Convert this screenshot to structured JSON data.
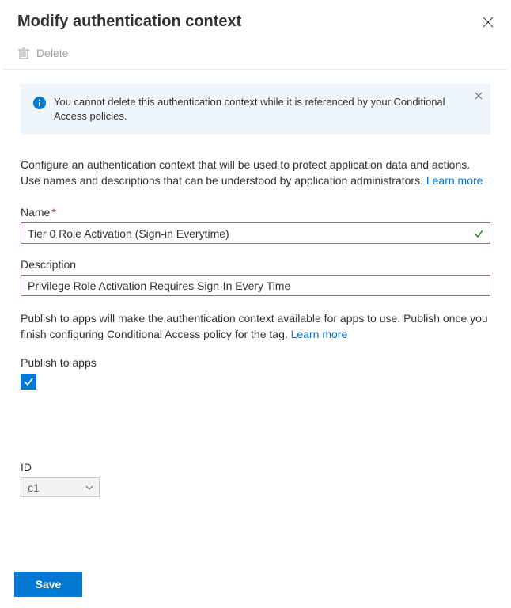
{
  "header": {
    "title": "Modify authentication context"
  },
  "toolbar": {
    "delete_label": "Delete"
  },
  "banner": {
    "message": "You cannot delete this authentication context while it is referenced by your Conditional Access policies."
  },
  "intro": {
    "text_part1": "Configure an authentication context that will be used to protect application data and actions. Use names and descriptions that can be understood by application administrators. ",
    "learn_more": "Learn more"
  },
  "fields": {
    "name_label": "Name",
    "name_value": "Tier 0 Role Activation (Sign-in Everytime)",
    "description_label": "Description",
    "description_value": "Privilege Role Activation Requires Sign-In Every Time"
  },
  "publish": {
    "text_part1": "Publish to apps will make the authentication context available for apps to use. Publish once you finish configuring Conditional Access policy for the tag. ",
    "learn_more": "Learn more",
    "label": "Publish to apps",
    "checked": true
  },
  "id_block": {
    "label": "ID",
    "value": "c1"
  },
  "footer": {
    "save_label": "Save"
  }
}
